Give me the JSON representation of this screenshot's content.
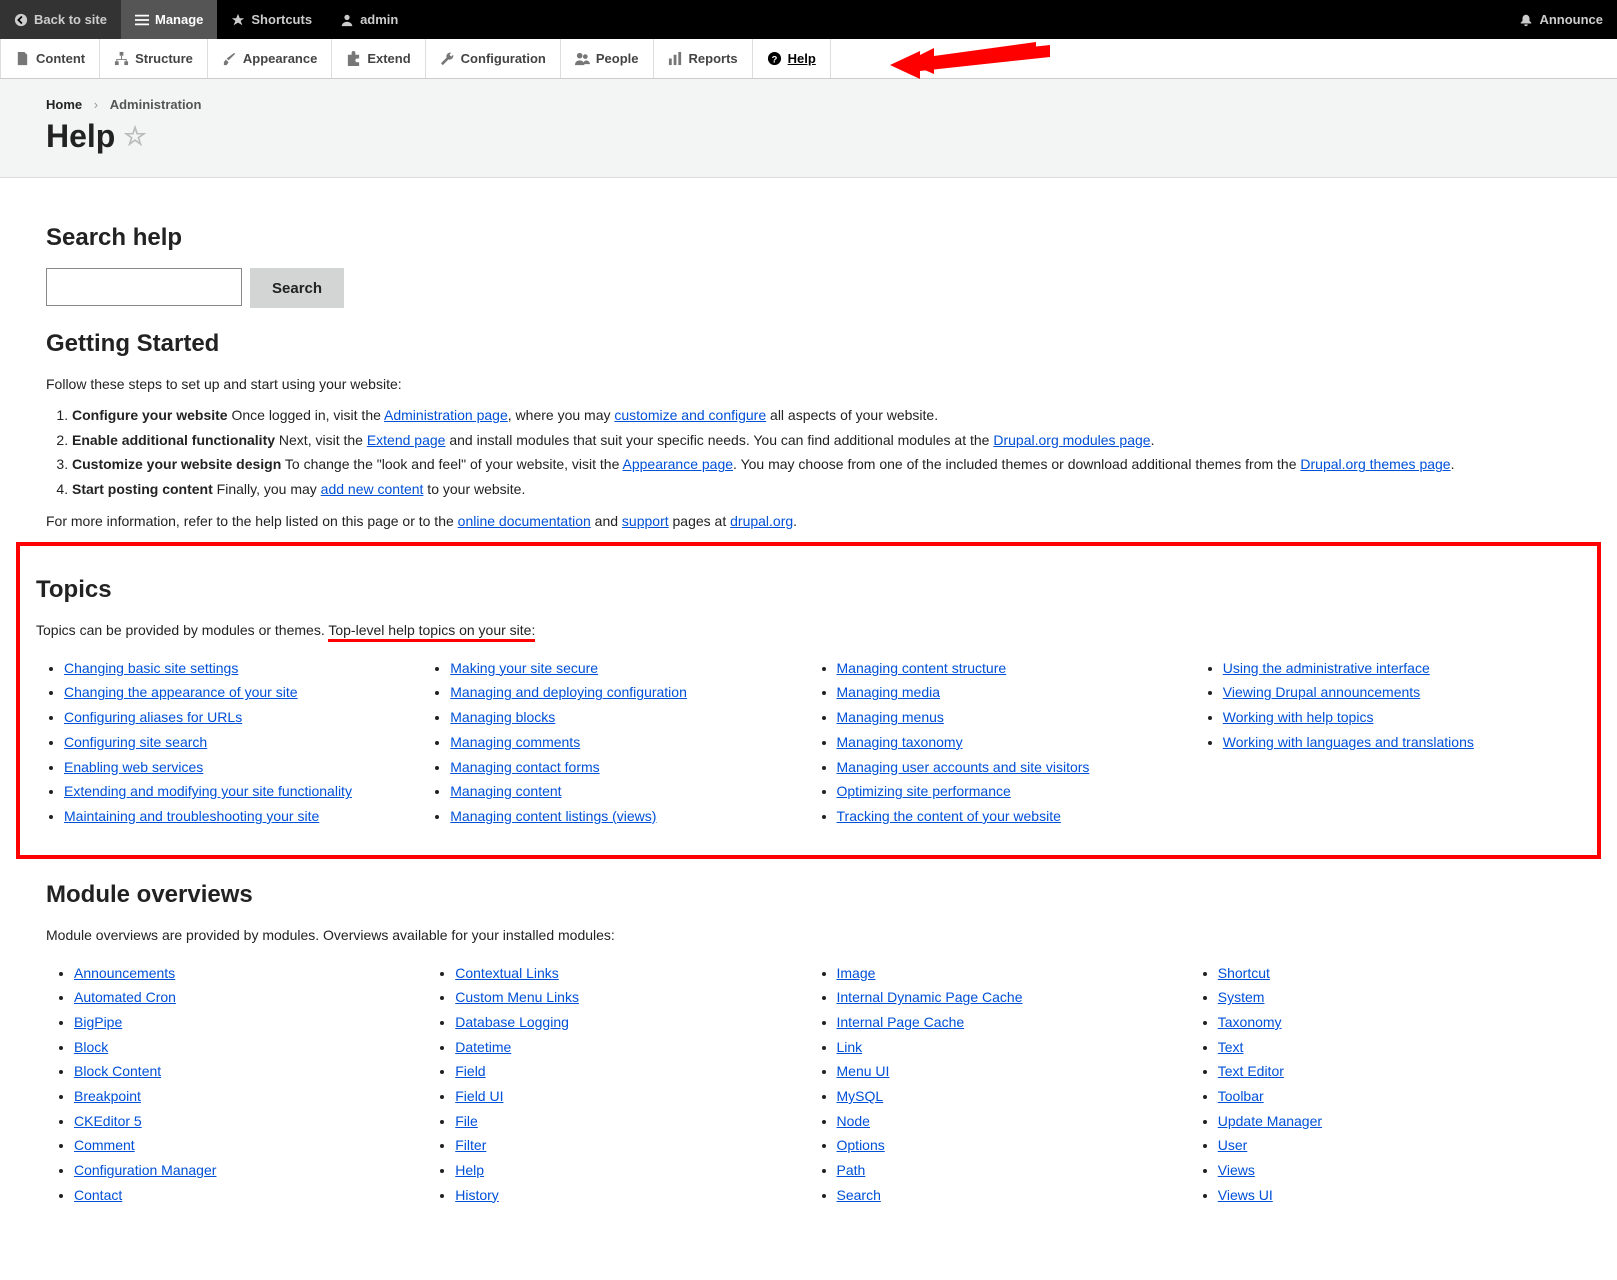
{
  "toolbar_top": {
    "back": "Back to site",
    "manage": "Manage",
    "shortcuts": "Shortcuts",
    "admin": "admin",
    "announce": "Announce"
  },
  "toolbar_admin": {
    "content": "Content",
    "structure": "Structure",
    "appearance": "Appearance",
    "extend": "Extend",
    "configuration": "Configuration",
    "people": "People",
    "reports": "Reports",
    "help": "Help"
  },
  "breadcrumb": {
    "home": "Home",
    "admin": "Administration"
  },
  "title": "Help",
  "search": {
    "heading": "Search help",
    "button": "Search"
  },
  "getting_started": {
    "heading": "Getting Started",
    "intro": "Follow these steps to set up and start using your website:",
    "step1_b": "Configure your website",
    "step1_t1": " Once logged in, visit the ",
    "step1_l1": "Administration page",
    "step1_t2": ", where you may ",
    "step1_l2": "customize and configure",
    "step1_t3": " all aspects of your website.",
    "step2_b": "Enable additional functionality",
    "step2_t1": " Next, visit the ",
    "step2_l1": "Extend page",
    "step2_t2": " and install modules that suit your specific needs. You can find additional modules at the ",
    "step2_l2": "Drupal.org modules page",
    "step2_t3": ".",
    "step3_b": "Customize your website design",
    "step3_t1": " To change the \"look and feel\" of your website, visit the ",
    "step3_l1": "Appearance page",
    "step3_t2": ". You may choose from one of the included themes or download additional themes from the ",
    "step3_l2": "Drupal.org themes page",
    "step3_t3": ".",
    "step4_b": "Start posting content",
    "step4_t1": " Finally, you may ",
    "step4_l1": "add new content",
    "step4_t2": " to your website.",
    "outro_t1": "For more information, refer to the help listed on this page or to the ",
    "outro_l1": "online documentation",
    "outro_t2": " and ",
    "outro_l2": "support",
    "outro_t3": " pages at ",
    "outro_l3": "drupal.org",
    "outro_t4": "."
  },
  "topics": {
    "heading": "Topics",
    "intro_t1": "Topics can be provided by modules or themes. ",
    "intro_u": "Top-level help topics on your site:",
    "col1": [
      "Changing basic site settings",
      "Changing the appearance of your site",
      "Configuring aliases for URLs",
      "Configuring site search",
      "Enabling web services",
      "Extending and modifying your site functionality",
      "Maintaining and troubleshooting your site"
    ],
    "col2": [
      "Making your site secure",
      "Managing and deploying configuration",
      "Managing blocks",
      "Managing comments",
      "Managing contact forms",
      "Managing content",
      "Managing content listings (views)"
    ],
    "col3": [
      "Managing content structure",
      "Managing media",
      "Managing menus",
      "Managing taxonomy",
      "Managing user accounts and site visitors",
      "Optimizing site performance",
      "Tracking the content of your website"
    ],
    "col4": [
      "Using the administrative interface",
      "Viewing Drupal announcements",
      "Working with help topics",
      "Working with languages and translations"
    ]
  },
  "modules": {
    "heading": "Module overviews",
    "intro": "Module overviews are provided by modules. Overviews available for your installed modules:",
    "col1": [
      "Announcements",
      "Automated Cron",
      "BigPipe",
      "Block",
      "Block Content",
      "Breakpoint",
      "CKEditor 5",
      "Comment",
      "Configuration Manager",
      "Contact"
    ],
    "col2": [
      "Contextual Links",
      "Custom Menu Links",
      "Database Logging",
      "Datetime",
      "Field",
      "Field UI",
      "File",
      "Filter",
      "Help",
      "History"
    ],
    "col3": [
      "Image",
      "Internal Dynamic Page Cache",
      "Internal Page Cache",
      "Link",
      "Menu UI",
      "MySQL",
      "Node",
      "Options",
      "Path",
      "Search"
    ],
    "col4": [
      "Shortcut",
      "System",
      "Taxonomy",
      "Text",
      "Text Editor",
      "Toolbar",
      "Update Manager",
      "User",
      "Views",
      "Views UI"
    ]
  }
}
